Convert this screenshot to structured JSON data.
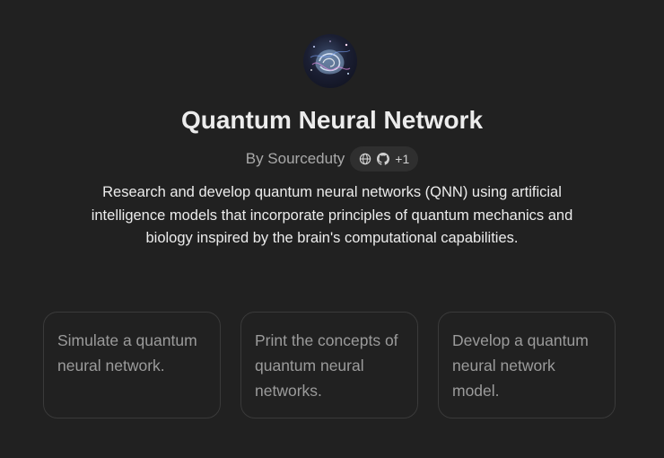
{
  "gpt": {
    "name": "Quantum Neural Network",
    "byline": "By Sourceduty",
    "links_extra": "+1",
    "description": "Research and develop quantum neural networks (QNN) using artificial intelligence models that incorporate principles of quantum mechanics and biology inspired by the brain's computational capabilities."
  },
  "starters": [
    {
      "label": "Simulate a quantum neural network."
    },
    {
      "label": "Print the concepts of quantum neural networks."
    },
    {
      "label": "Develop a quantum neural network model."
    }
  ],
  "icons": {
    "avatar": "quantum-brain-avatar",
    "link_1": "globe-icon",
    "link_2": "github-icon"
  },
  "colors": {
    "background": "#212121",
    "text": "#ececec",
    "muted": "#9b9b9b",
    "card_border": "#3a3a3a"
  }
}
